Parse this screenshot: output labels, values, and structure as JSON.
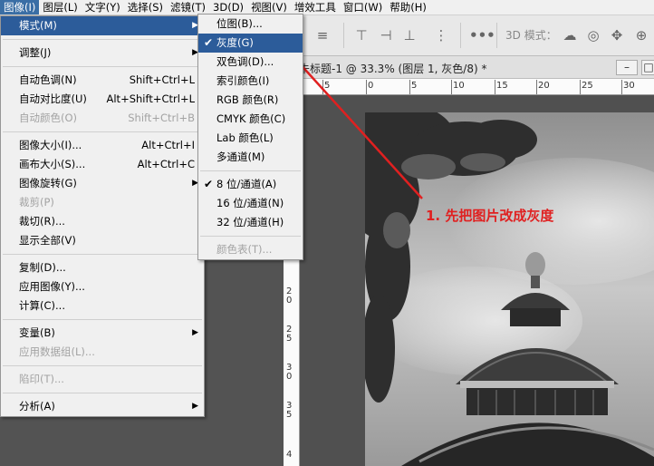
{
  "menubar": {
    "items": [
      "图像(I)",
      "图层(L)",
      "文字(Y)",
      "选择(S)",
      "滤镜(T)",
      "3D(D)",
      "视图(V)",
      "增效工具",
      "窗口(W)",
      "帮助(H)"
    ]
  },
  "options_bar": {
    "mode_3d_label": "3D 模式："
  },
  "document": {
    "tab_title": "未标题-1 @ 33.3% (图层 1, 灰色/8) *",
    "hruler_ticks": [
      "5",
      "0",
      "5",
      "10",
      "15",
      "20",
      "25",
      "30"
    ],
    "vruler_ticks": [
      "2",
      "0",
      "2",
      "5",
      "3",
      "0",
      "3",
      "5",
      "4"
    ]
  },
  "image_menu": {
    "items": [
      {
        "label": "模式(M)",
        "shortcut": "",
        "submenu": true,
        "state": "active"
      },
      {
        "sep": true
      },
      {
        "label": "调整(J)",
        "shortcut": "",
        "submenu": true,
        "state": "normal"
      },
      {
        "sep": true
      },
      {
        "label": "自动色调(N)",
        "shortcut": "Shift+Ctrl+L",
        "state": "normal"
      },
      {
        "label": "自动对比度(U)",
        "shortcut": "Alt+Shift+Ctrl+L",
        "state": "normal"
      },
      {
        "label": "自动颜色(O)",
        "shortcut": "Shift+Ctrl+B",
        "state": "disabled"
      },
      {
        "sep": true
      },
      {
        "label": "图像大小(I)...",
        "shortcut": "Alt+Ctrl+I",
        "state": "normal"
      },
      {
        "label": "画布大小(S)...",
        "shortcut": "Alt+Ctrl+C",
        "state": "normal"
      },
      {
        "label": "图像旋转(G)",
        "shortcut": "",
        "submenu": true,
        "state": "normal"
      },
      {
        "label": "裁剪(P)",
        "shortcut": "",
        "state": "disabled"
      },
      {
        "label": "裁切(R)...",
        "shortcut": "",
        "state": "normal"
      },
      {
        "label": "显示全部(V)",
        "shortcut": "",
        "state": "normal"
      },
      {
        "sep": true
      },
      {
        "label": "复制(D)...",
        "shortcut": "",
        "state": "normal"
      },
      {
        "label": "应用图像(Y)...",
        "shortcut": "",
        "state": "normal"
      },
      {
        "label": "计算(C)...",
        "shortcut": "",
        "state": "normal"
      },
      {
        "sep": true
      },
      {
        "label": "变量(B)",
        "shortcut": "",
        "submenu": true,
        "state": "normal"
      },
      {
        "label": "应用数据组(L)...",
        "shortcut": "",
        "state": "disabled"
      },
      {
        "sep": true
      },
      {
        "label": "陷印(T)...",
        "shortcut": "",
        "state": "disabled"
      },
      {
        "sep": true
      },
      {
        "label": "分析(A)",
        "shortcut": "",
        "submenu": true,
        "state": "normal"
      }
    ]
  },
  "mode_submenu": {
    "items": [
      {
        "label": "位图(B)...",
        "checked": false,
        "state": "normal"
      },
      {
        "label": "灰度(G)",
        "checked": true,
        "state": "active"
      },
      {
        "label": "双色调(D)...",
        "checked": false,
        "state": "normal"
      },
      {
        "label": "索引颜色(I)",
        "checked": false,
        "state": "normal"
      },
      {
        "label": "RGB 颜色(R)",
        "checked": false,
        "state": "normal"
      },
      {
        "label": "CMYK 颜色(C)",
        "checked": false,
        "state": "normal"
      },
      {
        "label": "Lab 颜色(L)",
        "checked": false,
        "state": "normal"
      },
      {
        "label": "多通道(M)",
        "checked": false,
        "state": "normal"
      },
      {
        "sep": true
      },
      {
        "label": "8 位/通道(A)",
        "checked": true,
        "state": "normal"
      },
      {
        "label": "16 位/通道(N)",
        "checked": false,
        "state": "normal"
      },
      {
        "label": "32 位/通道(H)",
        "checked": false,
        "state": "normal"
      },
      {
        "sep": true
      },
      {
        "label": "颜色表(T)...",
        "checked": false,
        "state": "disabled"
      }
    ]
  },
  "annotation": {
    "text": "1. 先把图片改成灰度",
    "color": "#e02020"
  }
}
